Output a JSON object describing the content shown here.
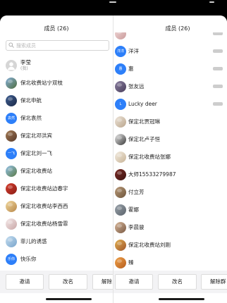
{
  "left": {
    "title": "成员 (26)",
    "search_placeholder": "搜索成员",
    "search_icon": "search-icon",
    "members": [
      {
        "name": "李莹",
        "sub": "(我)",
        "avatar": {
          "type": "default",
          "icon": "person-icon",
          "color": "#d6d6d6"
        }
      },
      {
        "name": "保北收费站宁双枝",
        "avatar": {
          "type": "photo",
          "colors": [
            "#86afd9",
            "#4f6e3e"
          ]
        }
      },
      {
        "name": "保北申航",
        "avatar": {
          "type": "photo",
          "colors": [
            "#3f5f92",
            "#1c2a48"
          ]
        }
      },
      {
        "name": "保北袁然",
        "avatar": {
          "type": "text",
          "text": "袁然",
          "color": "#2d7ff9"
        }
      },
      {
        "name": "保定北邓洪宾",
        "avatar": {
          "type": "photo",
          "colors": [
            "#a47c55",
            "#57392a"
          ]
        }
      },
      {
        "name": "保定北刘一飞",
        "avatar": {
          "type": "text",
          "text": "一飞",
          "color": "#2d7ff9"
        }
      },
      {
        "name": "保定北收费站",
        "avatar": {
          "type": "photo",
          "colors": [
            "#93c2e8",
            "#5b7a45"
          ]
        }
      },
      {
        "name": "保定北收费站边春宇",
        "avatar": {
          "type": "photo",
          "colors": [
            "#d63f2f",
            "#8b1d16"
          ]
        }
      },
      {
        "name": "保定北收费站李西西",
        "avatar": {
          "type": "photo",
          "colors": [
            "#f1d99e",
            "#b8874a"
          ]
        }
      },
      {
        "name": "保定北收费站杨雪霏",
        "avatar": {
          "type": "photo",
          "colors": [
            "#f5eaea",
            "#c8a6a6"
          ]
        }
      },
      {
        "name": "菲儿的诱惑",
        "avatar": {
          "type": "photo",
          "colors": [
            "#c6def0",
            "#78a4cb"
          ]
        }
      },
      {
        "name": "快乐你",
        "avatar": {
          "type": "text",
          "text": "乐你",
          "color": "#2d7ff9"
        }
      }
    ],
    "buttons": [
      "邀请",
      "改名",
      "解除"
    ]
  },
  "right": {
    "title": "成员 (26)",
    "members": [
      {
        "avatar": {
          "type": "photo",
          "colors": [
            "#f1d9d9",
            "#c99a9a"
          ]
        },
        "tag": true
      },
      {
        "name": "洋洋",
        "avatar": {
          "type": "text",
          "text": "洋洋",
          "color": "#2d7ff9"
        },
        "tag": true
      },
      {
        "name": "惠",
        "avatar": {
          "type": "text",
          "text": "惠",
          "color": "#2d7ff9"
        },
        "tag": true
      },
      {
        "name": "张友远",
        "avatar": {
          "type": "photo",
          "colors": [
            "#8a7fa0",
            "#4a3f5c"
          ]
        },
        "tag": true
      },
      {
        "name": "Lucky deer",
        "avatar": {
          "type": "text",
          "text": "L",
          "color": "#2d7ff9"
        },
        "tag": true
      },
      {
        "name": "保定北贾冠琳",
        "avatar": {
          "type": "photo",
          "colors": [
            "#eee5da",
            "#b9a58c"
          ]
        }
      },
      {
        "name": "保定北卢子恒",
        "avatar": {
          "type": "photo",
          "colors": [
            "#e9e9e9",
            "#3a3a3a"
          ]
        }
      },
      {
        "name": "保定北收费站张娜",
        "avatar": {
          "type": "photo",
          "colors": [
            "#f3ece1",
            "#c8b497"
          ]
        }
      },
      {
        "name": "大师15533279987",
        "avatar": {
          "type": "photo",
          "colors": [
            "#7b2b25",
            "#3e1512"
          ]
        }
      },
      {
        "name": "付立芳",
        "avatar": {
          "type": "photo",
          "colors": [
            "#b99a78",
            "#6e553c"
          ]
        }
      },
      {
        "name": "霍娜",
        "avatar": {
          "type": "photo",
          "colors": [
            "#9aa3ab",
            "#5b636b"
          ]
        }
      },
      {
        "name": "李晨骏",
        "avatar": {
          "type": "photo",
          "colors": [
            "#d8b79a",
            "#7a5a44"
          ]
        }
      },
      {
        "name": "保定北收费站刘刚",
        "avatar": {
          "type": "photo",
          "colors": [
            "#e2b04f",
            "#a0562c"
          ]
        }
      },
      {
        "name": "臻",
        "avatar": {
          "type": "photo",
          "colors": [
            "#f0a24a",
            "#b65d1c"
          ]
        }
      }
    ],
    "buttons": [
      "邀请",
      "改名",
      "解除群"
    ]
  }
}
